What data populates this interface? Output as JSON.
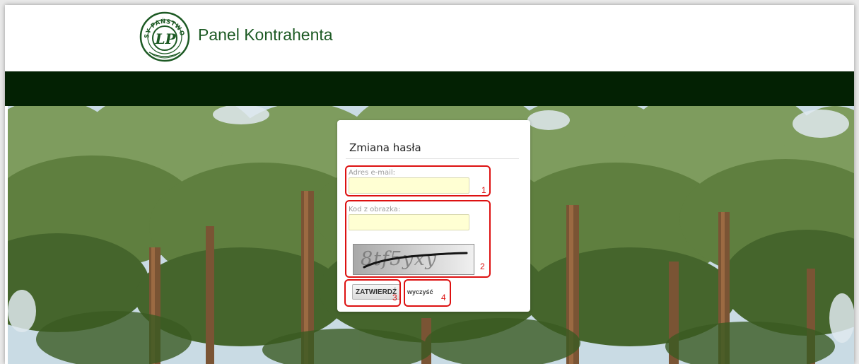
{
  "header": {
    "logo_name": "lasy-panstwowe-logo",
    "logo_ring_text": "LASY PAŃSTWOWE",
    "logo_mark_text": "LP",
    "title": "Panel Kontrahenta"
  },
  "form": {
    "title": "Zmiana hasła",
    "email_label": "Adres e-mail:",
    "email_value": "",
    "captcha_label": "Kod z obrazka:",
    "captcha_value": "",
    "captcha_image_text": "8tf5yxy",
    "submit_label": "ZATWIERDŹ",
    "clear_label": "wyczyść"
  },
  "annotations": {
    "n1": "1",
    "n2": "2",
    "n3": "3",
    "n4": "4"
  },
  "colors": {
    "brand_green": "#1d5a24",
    "navbar": "#032103",
    "input_bg": "#ffffd3",
    "annotation_red": "#dd1111"
  }
}
